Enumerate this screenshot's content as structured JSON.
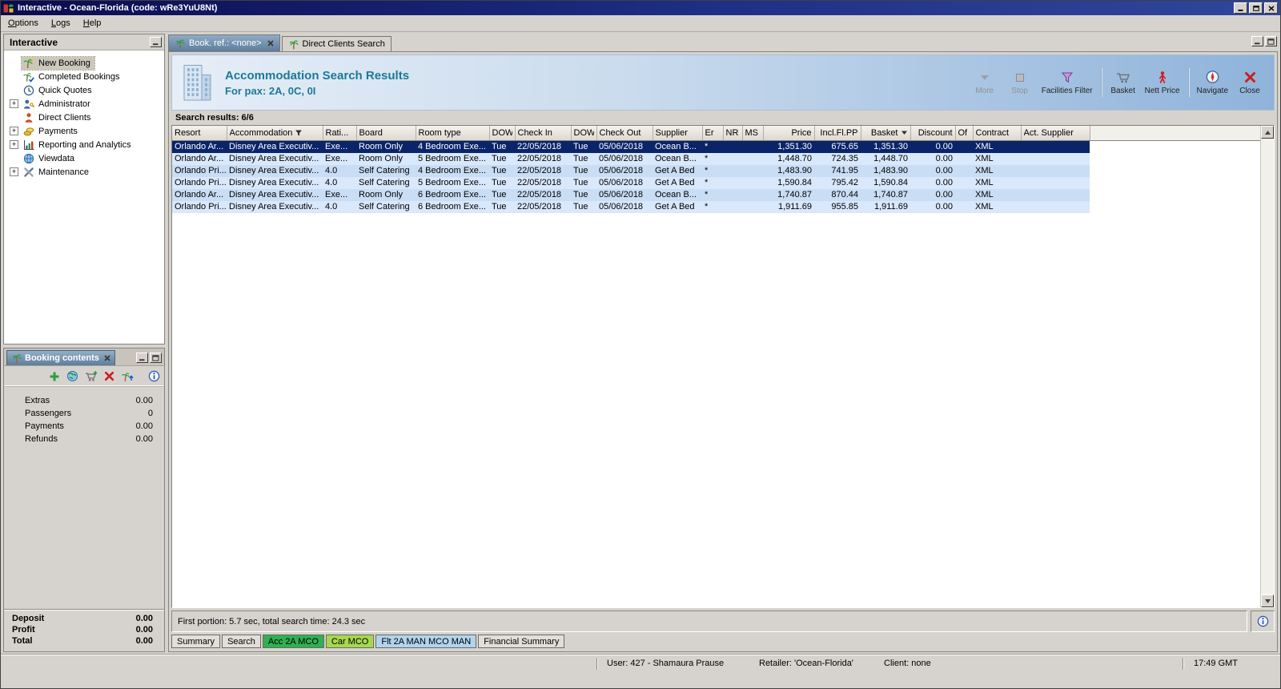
{
  "window": {
    "title": "Interactive - Ocean-Florida (code: wRe3YuU8Nt)",
    "status": {
      "user": "User: 427 - Shamaura Prause",
      "retailer": "Retailer: 'Ocean-Florida'",
      "client": "Client: none",
      "time": "17:49 GMT"
    }
  },
  "menubar": {
    "items": [
      {
        "label": "Options"
      },
      {
        "label": "Logs"
      },
      {
        "label": "Help"
      }
    ]
  },
  "sidebar": {
    "title": "Interactive",
    "items": [
      {
        "label": "New Booking",
        "icon": "new-booking",
        "expandable": false,
        "selected": true
      },
      {
        "label": "Completed Bookings",
        "icon": "completed-bookings",
        "expandable": false,
        "selected": false
      },
      {
        "label": "Quick Quotes",
        "icon": "quick-quotes",
        "expandable": false,
        "selected": false
      },
      {
        "label": "Administrator",
        "icon": "administrator",
        "expandable": true,
        "selected": false
      },
      {
        "label": "Direct Clients",
        "icon": "direct-clients",
        "expandable": false,
        "selected": false
      },
      {
        "label": "Payments",
        "icon": "payments",
        "expandable": true,
        "selected": false
      },
      {
        "label": "Reporting and Analytics",
        "icon": "reporting",
        "expandable": true,
        "selected": false
      },
      {
        "label": "Viewdata",
        "icon": "viewdata",
        "expandable": false,
        "selected": false
      },
      {
        "label": "Maintenance",
        "icon": "maintenance",
        "expandable": true,
        "selected": false
      }
    ]
  },
  "booking_contents": {
    "title": "Booking contents",
    "items": [
      {
        "label": "Extras",
        "value": "0.00"
      },
      {
        "label": "Passengers",
        "value": "0"
      },
      {
        "label": "Payments",
        "value": "0.00"
      },
      {
        "label": "Refunds",
        "value": "0.00"
      }
    ],
    "totals": [
      {
        "label": "Deposit",
        "value": "0.00"
      },
      {
        "label": "Profit",
        "value": "0.00"
      },
      {
        "label": "Total",
        "value": "0.00"
      }
    ]
  },
  "main": {
    "tabs": [
      {
        "label": "Book. ref.: <none>",
        "active": true,
        "closable": true
      },
      {
        "label": "Direct Clients Search",
        "active": false,
        "closable": false
      }
    ],
    "banner": {
      "title": "Accommodation Search Results",
      "subtitle": "For pax: 2A, 0C, 0I",
      "tools": [
        {
          "id": "more",
          "label": "More",
          "disabled": true
        },
        {
          "id": "stop",
          "label": "Stop",
          "disabled": true
        },
        {
          "id": "facilities-filter",
          "label": "Facilities Filter",
          "disabled": false
        },
        {
          "id": "basket",
          "label": "Basket",
          "disabled": false
        },
        {
          "id": "nett-price",
          "label": "Nett Price",
          "disabled": false
        },
        {
          "id": "navigate",
          "label": "Navigate",
          "disabled": false
        },
        {
          "id": "close",
          "label": "Close",
          "disabled": false
        }
      ]
    },
    "results_label": "Search results: 6/6",
    "status_line": "First portion: 5.7 sec, total search time: 24.3 sec",
    "bottom_tabs": [
      {
        "label": "Summary",
        "color": ""
      },
      {
        "label": "Search",
        "color": ""
      },
      {
        "label": "Acc 2A MCO",
        "color": "#2eb150"
      },
      {
        "label": "Car MCO",
        "color": "#a6d84e"
      },
      {
        "label": "Flt 2A MAN MCO MAN",
        "color": "#aed4ee"
      },
      {
        "label": "Financial Summary",
        "color": ""
      }
    ]
  },
  "results_table": {
    "columns": [
      "Resort",
      "Accommodation",
      "Rati...",
      "Board",
      "Room type",
      "DOW",
      "Check In",
      "DOW",
      "Check Out",
      "Supplier",
      "Er",
      "NR",
      "MS",
      "Price",
      "Incl.Fl.PP",
      "Basket",
      "Discount",
      "Of",
      "Contract",
      "Act. Supplier"
    ],
    "rows": [
      [
        "Orlando Ar...",
        "Disney Area Executiv...",
        "Exe...",
        "Room Only",
        "4 Bedroom Exe...",
        "Tue",
        "22/05/2018",
        "Tue",
        "05/06/2018",
        "Ocean B...",
        "*",
        "",
        "",
        "1,351.30",
        "675.65",
        "1,351.30",
        "0.00",
        "",
        "XML",
        ""
      ],
      [
        "Orlando Ar...",
        "Disney Area Executiv...",
        "Exe...",
        "Room Only",
        "5 Bedroom Exe...",
        "Tue",
        "22/05/2018",
        "Tue",
        "05/06/2018",
        "Ocean B...",
        "*",
        "",
        "",
        "1,448.70",
        "724.35",
        "1,448.70",
        "0.00",
        "",
        "XML",
        ""
      ],
      [
        "Orlando Pri...",
        "Disney Area Executiv...",
        "4.0",
        "Self Catering",
        "4 Bedroom Exe...",
        "Tue",
        "22/05/2018",
        "Tue",
        "05/06/2018",
        "Get A Bed",
        "*",
        "",
        "",
        "1,483.90",
        "741.95",
        "1,483.90",
        "0.00",
        "",
        "XML",
        ""
      ],
      [
        "Orlando Pri...",
        "Disney Area Executiv...",
        "4.0",
        "Self Catering",
        "5 Bedroom Exe...",
        "Tue",
        "22/05/2018",
        "Tue",
        "05/06/2018",
        "Get A Bed",
        "*",
        "",
        "",
        "1,590.84",
        "795.42",
        "1,590.84",
        "0.00",
        "",
        "XML",
        ""
      ],
      [
        "Orlando Ar...",
        "Disney Area Executiv...",
        "Exe...",
        "Room Only",
        "6 Bedroom Exe...",
        "Tue",
        "22/05/2018",
        "Tue",
        "05/06/2018",
        "Ocean B...",
        "*",
        "",
        "",
        "1,740.87",
        "870.44",
        "1,740.87",
        "0.00",
        "",
        "XML",
        ""
      ],
      [
        "Orlando Pri...",
        "Disney Area Executiv...",
        "4.0",
        "Self Catering",
        "6 Bedroom Exe...",
        "Tue",
        "22/05/2018",
        "Tue",
        "05/06/2018",
        "Get A Bed",
        "*",
        "",
        "",
        "1,911.69",
        "955.85",
        "1,911.69",
        "0.00",
        "",
        "XML",
        ""
      ]
    ],
    "selected_row": 0
  }
}
